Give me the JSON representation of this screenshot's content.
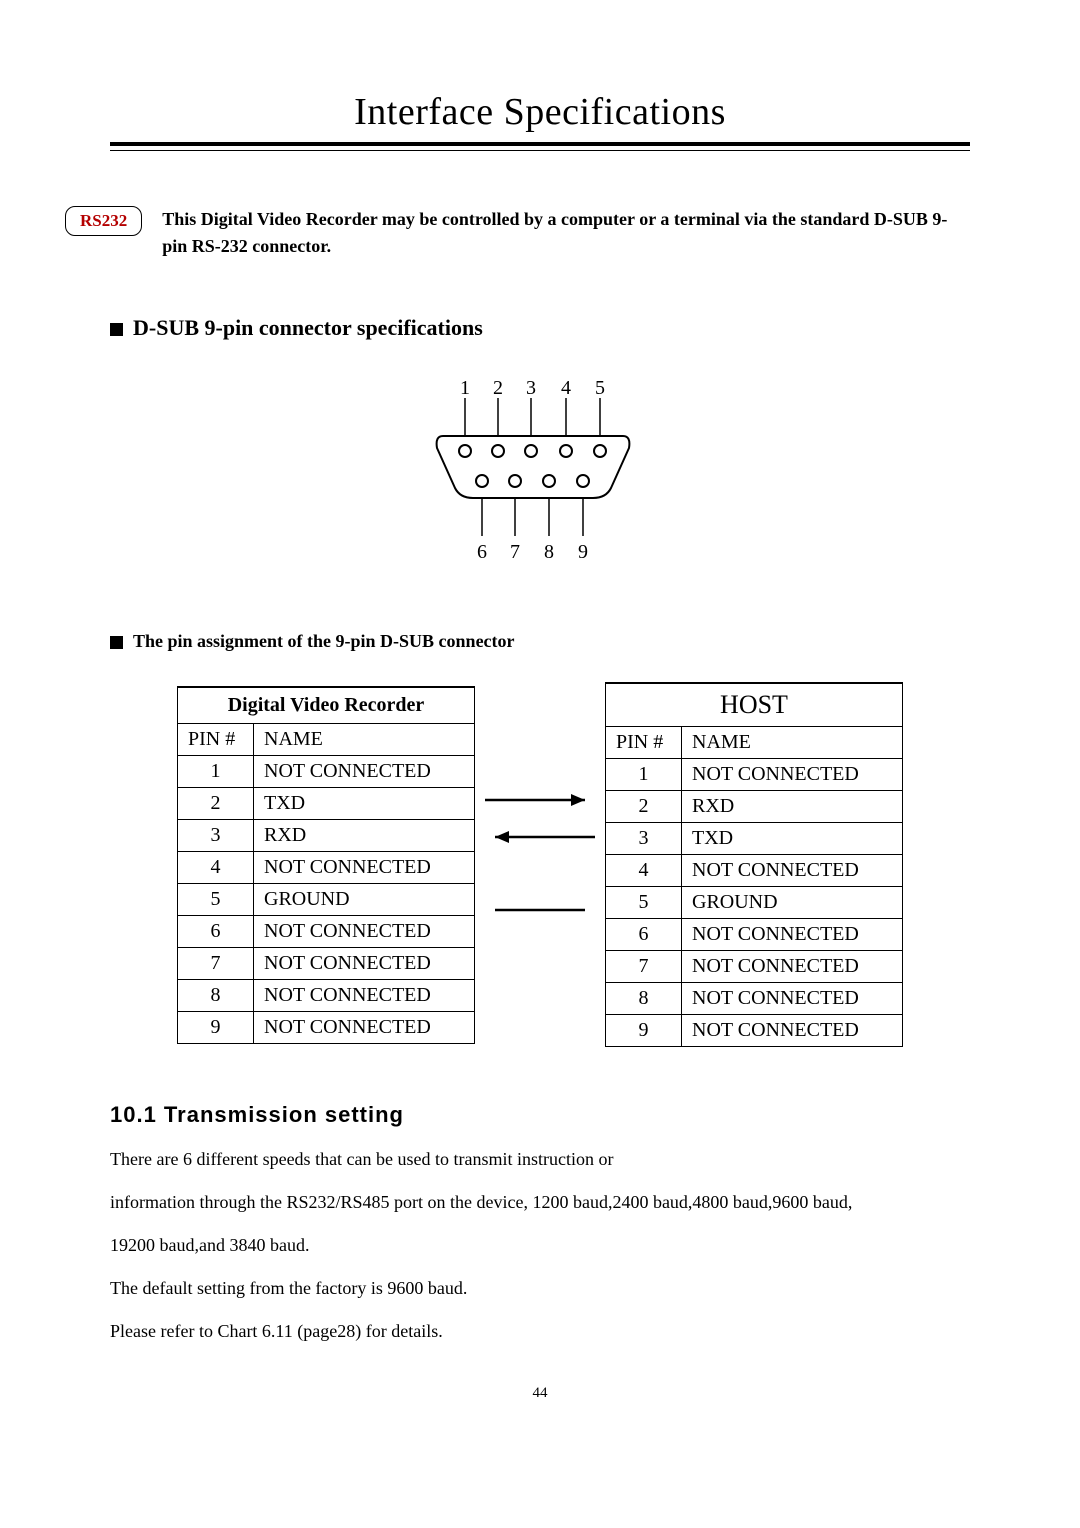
{
  "title": "Interface Specifications",
  "badge": "RS232",
  "intro": "This Digital Video Recorder may be controlled by a computer or a terminal via the standard D-SUB 9-pin RS-232 connector.",
  "section_connector": "D-SUB 9-pin connector specifications",
  "connector_pins": {
    "top": [
      "1",
      "2",
      "3",
      "4",
      "5"
    ],
    "bottom": [
      "6",
      "7",
      "8",
      "9"
    ]
  },
  "section_pins": "The pin assignment of the 9-pin D-SUB connector",
  "dvr_table": {
    "title": "Digital Video Recorder",
    "col1": "PIN #",
    "col2": "NAME",
    "rows": [
      {
        "pin": "1",
        "name": "NOT CONNECTED"
      },
      {
        "pin": "2",
        "name": "TXD"
      },
      {
        "pin": "3",
        "name": "RXD"
      },
      {
        "pin": "4",
        "name": "NOT CONNECTED"
      },
      {
        "pin": "5",
        "name": "GROUND"
      },
      {
        "pin": "6",
        "name": "NOT CONNECTED"
      },
      {
        "pin": "7",
        "name": "NOT CONNECTED"
      },
      {
        "pin": "8",
        "name": "NOT CONNECTED"
      },
      {
        "pin": "9",
        "name": "NOT CONNECTED"
      }
    ]
  },
  "host_table": {
    "title": "HOST",
    "col1": "PIN #",
    "col2": "NAME",
    "rows": [
      {
        "pin": "1",
        "name": "NOT CONNECTED"
      },
      {
        "pin": "2",
        "name": "RXD"
      },
      {
        "pin": "3",
        "name": "TXD"
      },
      {
        "pin": "4",
        "name": "NOT CONNECTED"
      },
      {
        "pin": "5",
        "name": "GROUND"
      },
      {
        "pin": "6",
        "name": "NOT CONNECTED"
      },
      {
        "pin": "7",
        "name": "NOT CONNECTED"
      },
      {
        "pin": "8",
        "name": "NOT CONNECTED"
      },
      {
        "pin": "9",
        "name": "NOT CONNECTED"
      }
    ]
  },
  "trans_heading": "10.1 Transmission setting",
  "trans_p1": "There are 6 different speeds that can be used to transmit instruction or",
  "trans_p2": "information through the RS232/RS485 port on the device, 1200 baud,2400 baud,4800 baud,9600 baud,",
  "trans_p3": "19200 baud,and 3840 baud.",
  "trans_p4": "The default setting from the factory is 9600 baud.",
  "trans_p5": "Please refer to Chart 6.11 (page28) for details.",
  "page_number": "44"
}
